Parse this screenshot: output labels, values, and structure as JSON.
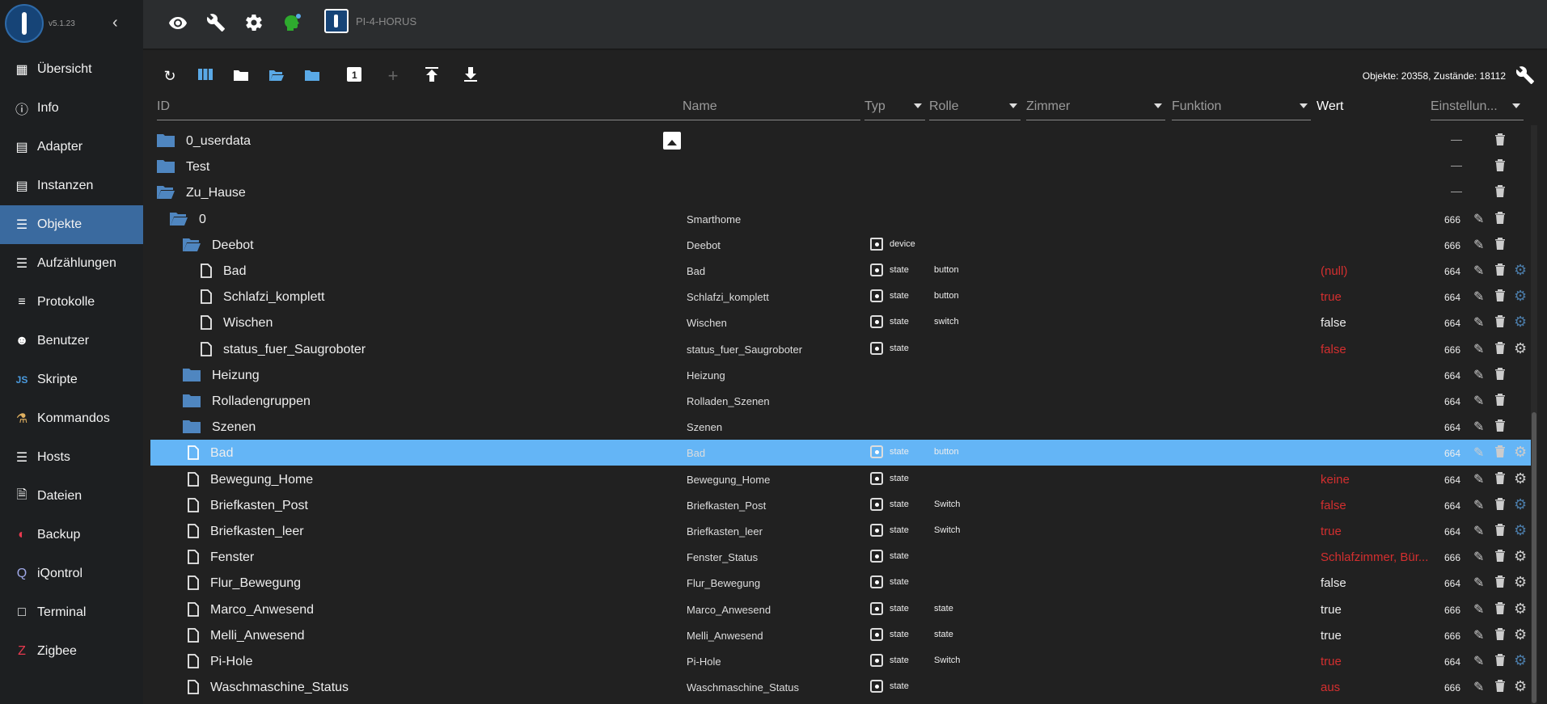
{
  "app": {
    "version": "v5.1.23",
    "host": "PI-4-HORUS"
  },
  "sidebar": {
    "items": [
      {
        "label": "Übersicht",
        "icon": "grid-icon"
      },
      {
        "label": "Info",
        "icon": "info-icon"
      },
      {
        "label": "Adapter",
        "icon": "store-icon"
      },
      {
        "label": "Instanzen",
        "icon": "instances-icon"
      },
      {
        "label": "Objekte",
        "icon": "list-icon",
        "active": true
      },
      {
        "label": "Aufzählungen",
        "icon": "enum-icon"
      },
      {
        "label": "Protokolle",
        "icon": "log-icon"
      },
      {
        "label": "Benutzer",
        "icon": "user-icon"
      },
      {
        "label": "Skripte",
        "icon": "js-icon"
      },
      {
        "label": "Kommandos",
        "icon": "commands-icon"
      },
      {
        "label": "Hosts",
        "icon": "hosts-icon"
      },
      {
        "label": "Dateien",
        "icon": "files-icon"
      },
      {
        "label": "Backup",
        "icon": "backup-icon"
      },
      {
        "label": "iQontrol",
        "icon": "iqontrol-icon"
      },
      {
        "label": "Terminal",
        "icon": "terminal-icon"
      },
      {
        "label": "Zigbee",
        "icon": "zigbee-icon"
      }
    ]
  },
  "toolbar": {
    "count": "Objekte: 20358, Zustände: 18112"
  },
  "header": {
    "id": "ID",
    "name": "Name",
    "typ": "Typ",
    "rolle": "Rolle",
    "zimmer": "Zimmer",
    "funktion": "Funktion",
    "wert": "Wert",
    "settings": "Einstellun..."
  },
  "rows": [
    {
      "id": "0_userdata",
      "kind": "folder",
      "level": 0,
      "name": "",
      "typ": "",
      "role": "",
      "value": "",
      "acl": "—",
      "img": true
    },
    {
      "id": "Test",
      "kind": "folder",
      "level": 0,
      "name": "",
      "typ": "",
      "role": "",
      "value": "",
      "acl": "—"
    },
    {
      "id": "Zu_Hause",
      "kind": "folder-open",
      "level": 0,
      "name": "",
      "typ": "",
      "role": "",
      "value": "",
      "acl": "—"
    },
    {
      "id": "0",
      "kind": "folder-open",
      "level": 1,
      "name": "Smarthome",
      "typ": "",
      "role": "",
      "value": "",
      "acl": "666"
    },
    {
      "id": "Deebot",
      "kind": "folder-open",
      "level": 2,
      "name": "Deebot",
      "typ": "device",
      "role": "",
      "value": "",
      "acl": "666"
    },
    {
      "id": "Bad",
      "kind": "file",
      "level": 3,
      "name": "Bad",
      "typ": "state",
      "role": "button",
      "value": "(null)",
      "red": true,
      "acl": "664",
      "gear": "blue"
    },
    {
      "id": "Schlafzi_komplett",
      "kind": "file",
      "level": 3,
      "name": "Schlafzi_komplett",
      "typ": "state",
      "role": "button",
      "value": "true",
      "red": true,
      "acl": "664",
      "gear": "blue"
    },
    {
      "id": "Wischen",
      "kind": "file",
      "level": 3,
      "name": "Wischen",
      "typ": "state",
      "role": "switch",
      "value": "false",
      "red": false,
      "acl": "664",
      "gear": "blue"
    },
    {
      "id": "status_fuer_Saugroboter",
      "kind": "file",
      "level": 3,
      "name": "status_fuer_Saugroboter",
      "typ": "state",
      "role": "",
      "value": "false",
      "red": true,
      "acl": "666",
      "gear": "white"
    },
    {
      "id": "Heizung",
      "kind": "folder",
      "level": 2,
      "name": "Heizung",
      "typ": "",
      "role": "",
      "value": "",
      "acl": "664"
    },
    {
      "id": "Rolladengruppen",
      "kind": "folder",
      "level": 2,
      "name": "Rolladen_Szenen",
      "typ": "",
      "role": "",
      "value": "",
      "acl": "664"
    },
    {
      "id": "Szenen",
      "kind": "folder",
      "level": 2,
      "name": "Szenen",
      "typ": "",
      "role": "",
      "value": "",
      "acl": "664"
    },
    {
      "id": "Bad",
      "kind": "file",
      "level": 2,
      "name": "Bad",
      "typ": "state",
      "role": "button",
      "value": "",
      "acl": "664",
      "gear": "white",
      "selected": true
    },
    {
      "id": "Bewegung_Home",
      "kind": "file",
      "level": 2,
      "name": "Bewegung_Home",
      "typ": "state",
      "role": "",
      "value": "keine",
      "red": true,
      "acl": "664",
      "gear": "white"
    },
    {
      "id": "Briefkasten_Post",
      "kind": "file",
      "level": 2,
      "name": "Briefkasten_Post",
      "typ": "state",
      "role": "Switch",
      "value": "false",
      "red": true,
      "acl": "664",
      "gear": "blue"
    },
    {
      "id": "Briefkasten_leer",
      "kind": "file",
      "level": 2,
      "name": "Briefkasten_leer",
      "typ": "state",
      "role": "Switch",
      "value": "true",
      "red": true,
      "acl": "664",
      "gear": "blue"
    },
    {
      "id": "Fenster",
      "kind": "file",
      "level": 2,
      "name": "Fenster_Status",
      "typ": "state",
      "role": "",
      "value": "Schlafzimmer, Bür...",
      "red": true,
      "acl": "666",
      "gear": "white"
    },
    {
      "id": "Flur_Bewegung",
      "kind": "file",
      "level": 2,
      "name": "Flur_Bewegung",
      "typ": "state",
      "role": "",
      "value": "false",
      "red": false,
      "acl": "664",
      "gear": "white"
    },
    {
      "id": "Marco_Anwesend",
      "kind": "file",
      "level": 2,
      "name": "Marco_Anwesend",
      "typ": "state",
      "role": "state",
      "value": "true",
      "red": false,
      "acl": "666",
      "gear": "white"
    },
    {
      "id": "Melli_Anwesend",
      "kind": "file",
      "level": 2,
      "name": "Melli_Anwesend",
      "typ": "state",
      "role": "state",
      "value": "true",
      "red": false,
      "acl": "666",
      "gear": "white"
    },
    {
      "id": "Pi-Hole",
      "kind": "file",
      "level": 2,
      "name": "Pi-Hole",
      "typ": "state",
      "role": "Switch",
      "value": "true",
      "red": true,
      "acl": "664",
      "gear": "blue"
    },
    {
      "id": "Waschmaschine_Status",
      "kind": "file",
      "level": 2,
      "name": "Waschmaschine_Status",
      "typ": "state",
      "role": "",
      "value": "aus",
      "red": true,
      "acl": "666",
      "gear": "white"
    }
  ]
}
